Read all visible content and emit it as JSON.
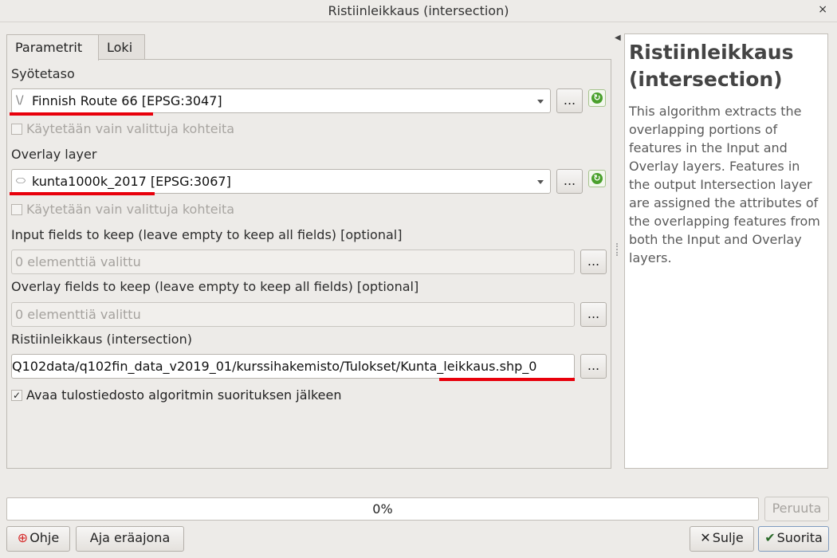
{
  "window": {
    "title": "Ristiinleikkaus (intersection)",
    "close_glyph": "×"
  },
  "tabs": [
    {
      "label": "Parametrit",
      "active": true
    },
    {
      "label": "Loki",
      "active": false
    }
  ],
  "form": {
    "input_layer": {
      "label": "Syötetaso",
      "value": "Finnish Route 66 [EPSG:3047]",
      "icon": "line-layer-icon",
      "icon_glyph": "\\/",
      "browse_label": "...",
      "selected_only": {
        "label": "Käytetään vain valittuja kohteita",
        "checked": false,
        "enabled": false
      }
    },
    "overlay_layer": {
      "label": "Overlay layer",
      "value": "kunta1000k_2017 [EPSG:3067]",
      "icon": "polygon-layer-icon",
      "icon_glyph": "⬭",
      "browse_label": "...",
      "selected_only": {
        "label": "Käytetään vain valittuja kohteita",
        "checked": false,
        "enabled": false
      }
    },
    "input_fields": {
      "label": "Input fields to keep (leave empty to keep all fields) [optional]",
      "value": "0 elementtiä valittu",
      "browse_label": "..."
    },
    "overlay_fields": {
      "label": "Overlay fields to keep (leave empty to keep all fields) [optional]",
      "value": "0 elementtiä valittu",
      "browse_label": "..."
    },
    "output": {
      "label": "Ristiinleikkaus (intersection)",
      "value": "0_Q102data/q102fin_data_v2019_01/kurssihakemisto/Tulokset/Kunta_leikkaus.shp",
      "browse_label": "..."
    },
    "open_output": {
      "label": "Avaa tulostiedosto algoritmin suorituksen jälkeen",
      "checked": true
    }
  },
  "help": {
    "title": "Ristiinleikkaus (intersection)",
    "body": "This algorithm extracts the overlapping portions of features in the Input and Overlay layers. Features in the output Intersection layer are assigned the attributes of the overlapping features from both the Input and Overlay layers."
  },
  "progress": {
    "value": 0,
    "text": "0%"
  },
  "buttons": {
    "cancel": "Peruuta",
    "help": "Ohje",
    "batch": "Aja eräajona",
    "close": "Sulje",
    "run": "Suorita"
  },
  "colors": {
    "highlight": "#e8000b",
    "progress_fill": "#3d8ee0"
  }
}
